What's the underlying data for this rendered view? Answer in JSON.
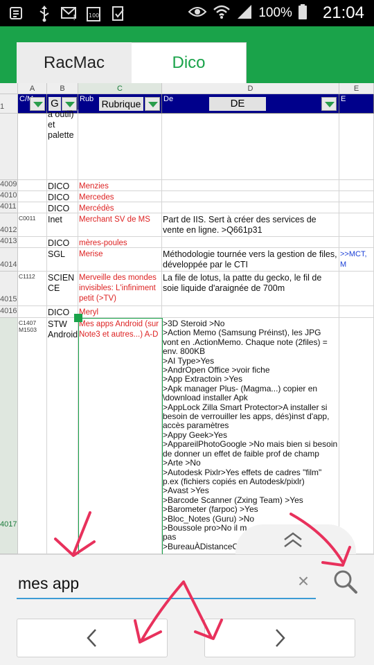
{
  "status_bar": {
    "battery": "100%",
    "time": "21:04",
    "icons": [
      "notification-icon",
      "usb-icon",
      "mail-icon",
      "battery-full-icon",
      "task-icon",
      "eye-icon",
      "wifi-icon",
      "signal-icon"
    ]
  },
  "tabs": [
    {
      "label": "RacMac",
      "active": false
    },
    {
      "label": "Dico",
      "active": true
    }
  ],
  "colors": {
    "accent": "#1aa34a",
    "header_blue": "#00008b",
    "highlight_red": "#d22222",
    "link_blue": "#1a3fd6"
  },
  "sheet": {
    "col_headers": [
      "A",
      "B",
      "C",
      "D",
      "E"
    ],
    "row1": {
      "num": "1",
      "a_label": "C/M",
      "b_label": "G",
      "c_label": "Rub",
      "c_header": "Rubrique",
      "d_label": "De",
      "d_header": "DE",
      "e_label": "E"
    },
    "partial_row": {
      "b": "a outil)\net\npalette"
    },
    "rows": [
      {
        "num": "4009",
        "a": "",
        "b": "DICO",
        "c": "Menzies",
        "d": "",
        "e": ""
      },
      {
        "num": "4010",
        "a": "",
        "b": "DICO",
        "c": "Mercedes",
        "d": "",
        "e": ""
      },
      {
        "num": "4011",
        "a": "",
        "b": "DICO",
        "c": "Mercédès",
        "d": "",
        "e": ""
      },
      {
        "num": "4012",
        "a": "C0011",
        "b": "Inet",
        "c": "Merchant SV de MS",
        "d": "Part de IIS. Sert à créer des services de vente en ligne. >Q661p31",
        "e": ""
      },
      {
        "num": "4013",
        "a": "",
        "b": "DICO",
        "c": "mères-poules",
        "d": "",
        "e": ""
      },
      {
        "num": "4014",
        "a": "",
        "b": "SGL",
        "c": "Merise",
        "d": "Méthodologie tournée vers la gestion de files, développée par le CTI",
        "e": ">>MCT, M"
      },
      {
        "num": "4015",
        "a": "C1112",
        "b": "SCIENCE",
        "c": "Merveille des mondes invisibles: L'infiniment petit (>TV)",
        "d": "La file de lotus, la patte du gecko, le fil de soie liquide d'araignée de 700m",
        "e": ""
      },
      {
        "num": "4016",
        "a": "",
        "b": "DICO",
        "c": "Meryl",
        "d": "",
        "e": ""
      },
      {
        "num": "4017",
        "a": "C1407\nM1503",
        "b": "STW\nAndroid",
        "c": "Mes apps Android (sur Note3 et autres...) A-D",
        "d": ">3D Steroid >No\n>Action Memo (Samsung Préinst), les JPG vont en .ActionMemo. Chaque note (2files) = env. 800KB\n>AI Type>Yes\n>AndrOpen Office >voir fiche\n>App Extractoin >Yes\n>Apk manager Plus- (Magma...) copier en \\download installer Apk\n>AppLock Zilla Smart Protector>A installer si besoin de verrouiller les apps, dés)inst d'app, accès paramètres\n>Appy Geek>Yes\n>AppareilPhotoGoogle >No mais bien si besoin de donner un effet de faible prof de champ\n>Arte >No\n>Autodesk Pixlr>Yes effets de cadres \"film\" p.ex (fichiers copiés en Autodesk/pixlr)\n>Avast >Yes\n>Barcode Scanner (Zxing Team) >Yes\n>Barometer (farpoc) >Yes\n>Bloc_Notes (Guru) >No\n>Boussole pro>No il m\npas\n>BureauÀDistanceC",
        "e": ""
      }
    ]
  },
  "find_bar": {
    "query": "mes app"
  }
}
